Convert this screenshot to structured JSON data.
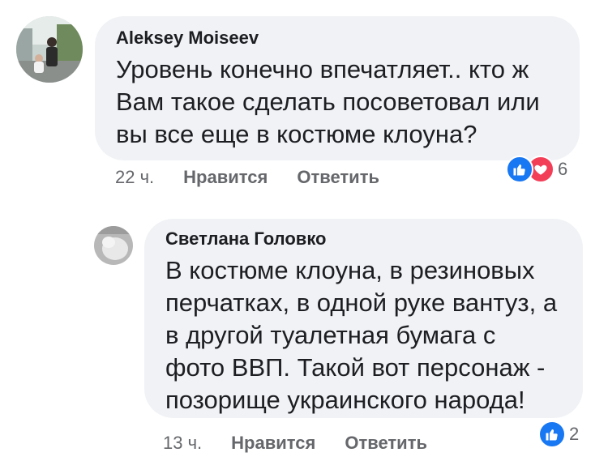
{
  "comments": [
    {
      "author": "Aleksey Moiseev",
      "text": "Уровень конечно впечатляет.. кто ж Вам такое сделать посоветовал или вы все еще в костюме клоуна?",
      "time": "22 ч.",
      "like_label": "Нравится",
      "reply_label": "Ответить",
      "reactions": [
        "like-icon",
        "love-icon"
      ],
      "reaction_count": "6"
    },
    {
      "author": "Светлана Головко",
      "text": "В костюме клоуна, в резиновых перчатках, в одной руке вантуз, а в другой туалетная бумага с фото ВВП. Такой вот персонаж - позорище украинского народа!",
      "time": "13 ч.",
      "like_label": "Нравится",
      "reply_label": "Ответить",
      "reactions": [
        "like-icon"
      ],
      "reaction_count": "2"
    }
  ],
  "colors": {
    "bubble": "#f0f2f5",
    "like": "#1877f2",
    "love": "#f33e58",
    "meta": "#65676b"
  }
}
